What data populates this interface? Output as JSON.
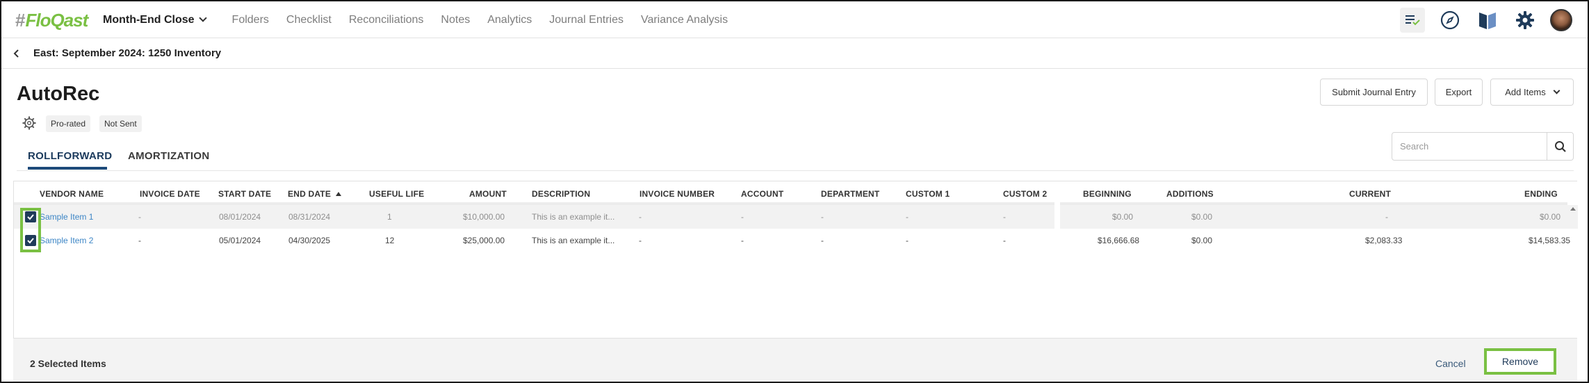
{
  "app": {
    "logo_hash": "#",
    "logo_text": "FloQast"
  },
  "nav": {
    "active": "Month-End Close",
    "items": [
      "Folders",
      "Checklist",
      "Reconciliations",
      "Notes",
      "Analytics",
      "Journal Entries",
      "Variance Analysis"
    ],
    "icons": [
      "tasks-check-icon",
      "compass-icon",
      "book-icon",
      "gear-icon",
      "avatar"
    ]
  },
  "breadcrumb": {
    "text": "East: September 2024: 1250 Inventory"
  },
  "page": {
    "title": "AutoRec",
    "badges": [
      "Pro-rated",
      "Not Sent"
    ]
  },
  "actions": {
    "submit_je": "Submit Journal Entry",
    "export": "Export",
    "add_items": "Add Items"
  },
  "tabs": [
    "ROLLFORWARD",
    "AMORTIZATION"
  ],
  "search": {
    "placeholder": "Search"
  },
  "table": {
    "columns": [
      "VENDOR NAME",
      "INVOICE DATE",
      "START DATE",
      "END DATE",
      "USEFUL LIFE",
      "AMOUNT",
      "DESCRIPTION",
      "INVOICE NUMBER",
      "ACCOUNT",
      "DEPARTMENT",
      "CUSTOM 1",
      "CUSTOM 2",
      "BEGINNING",
      "ADDITIONS",
      "CURRENT",
      "ENDING"
    ],
    "sorted_column": "END DATE",
    "rows": [
      {
        "vendor": "Sample Item 1",
        "invoice_date": "-",
        "start_date": "08/01/2024",
        "end_date": "08/31/2024",
        "useful_life": "1",
        "amount": "$10,000.00",
        "description": "This is an example it...",
        "invoice_number": "-",
        "account": "-",
        "department": "-",
        "custom1": "-",
        "custom2": "-",
        "beginning": "$0.00",
        "additions": "$0.00",
        "current": "-",
        "ending": "$0.00",
        "checked": true
      },
      {
        "vendor": "Sample Item 2",
        "invoice_date": "-",
        "start_date": "05/01/2024",
        "end_date": "04/30/2025",
        "useful_life": "12",
        "amount": "$25,000.00",
        "description": "This is an example it...",
        "invoice_number": "-",
        "account": "-",
        "department": "-",
        "custom1": "-",
        "custom2": "-",
        "beginning": "$16,666.68",
        "additions": "$0.00",
        "current": "$2,083.33",
        "ending": "$14,583.35",
        "checked": true
      }
    ]
  },
  "footer": {
    "selected": "2 Selected Items",
    "cancel": "Cancel",
    "remove": "Remove"
  },
  "colors": {
    "brand_green": "#7ac043",
    "navy": "#1f3b5a",
    "link": "#3d86c6"
  }
}
